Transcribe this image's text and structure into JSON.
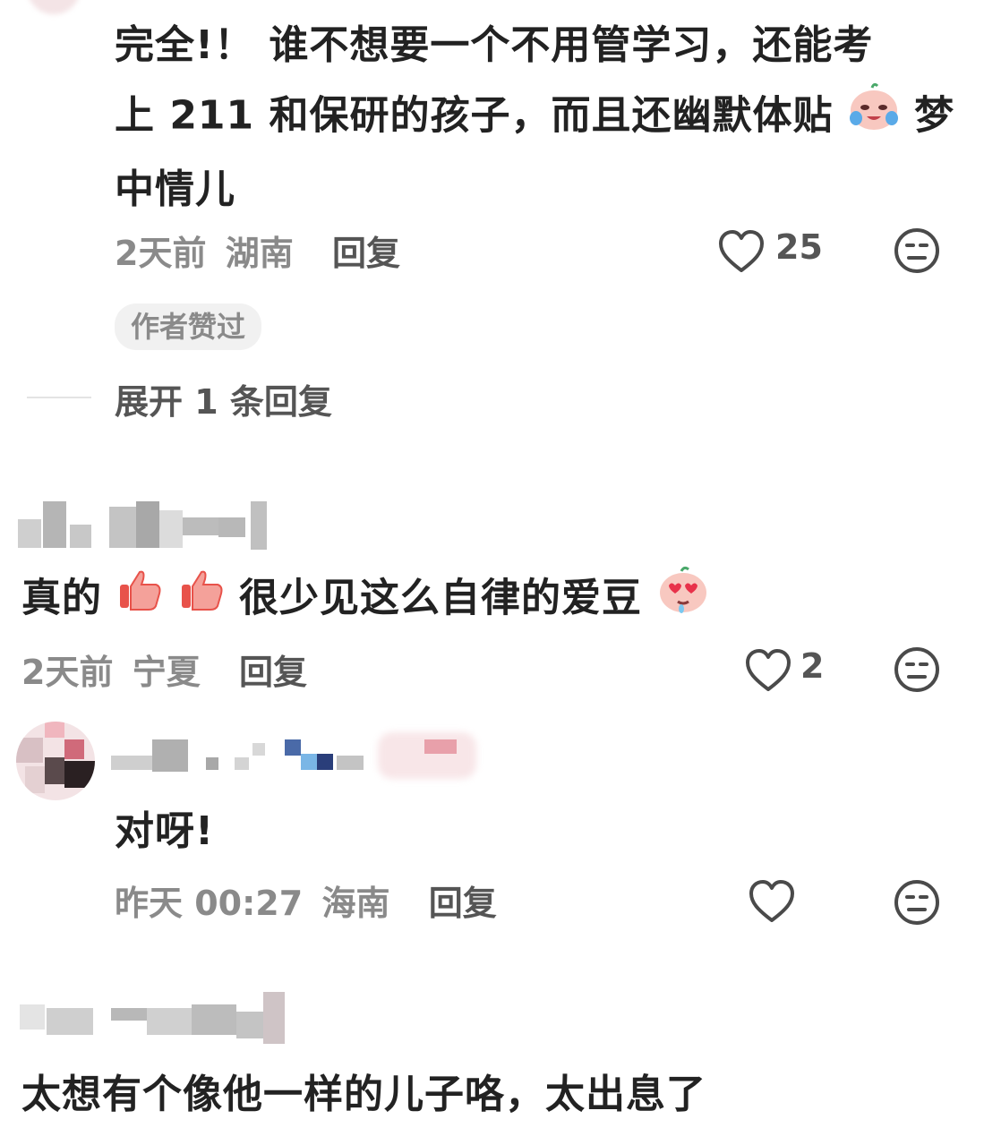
{
  "comment1": {
    "text_line1": "完全!！ 谁不想要一个不用管学习，还能考",
    "text_line2": "上 211 和保研的孩子，而且还幽默体贴",
    "text_line2_tail": "梦",
    "text_line3": "中情儿",
    "time": "2天前",
    "location": "湖南",
    "reply_label": "回复",
    "likes": "25",
    "author_liked_tag": "作者赞过",
    "expand_label": "展开 1 条回复"
  },
  "comment2": {
    "text_part1": "真的",
    "text_part2": "很少见这么自律的爱豆",
    "time": "2天前",
    "location": "宁夏",
    "reply_label": "回复",
    "likes": "2"
  },
  "comment3": {
    "text": "对呀!",
    "time": "昨天 00:27",
    "location": "海南",
    "reply_label": "回复"
  },
  "comment4": {
    "text": "太想有个像他一样的儿子咯，太出息了"
  },
  "colors": {
    "text": "#222222",
    "meta": "#8a8a8a",
    "icon": "#4a4a4a"
  },
  "icons": [
    "heart-outline-icon",
    "neutral-face-icon",
    "crying-emoji",
    "thumbs-up-emoji",
    "heart-eyes-emoji"
  ]
}
